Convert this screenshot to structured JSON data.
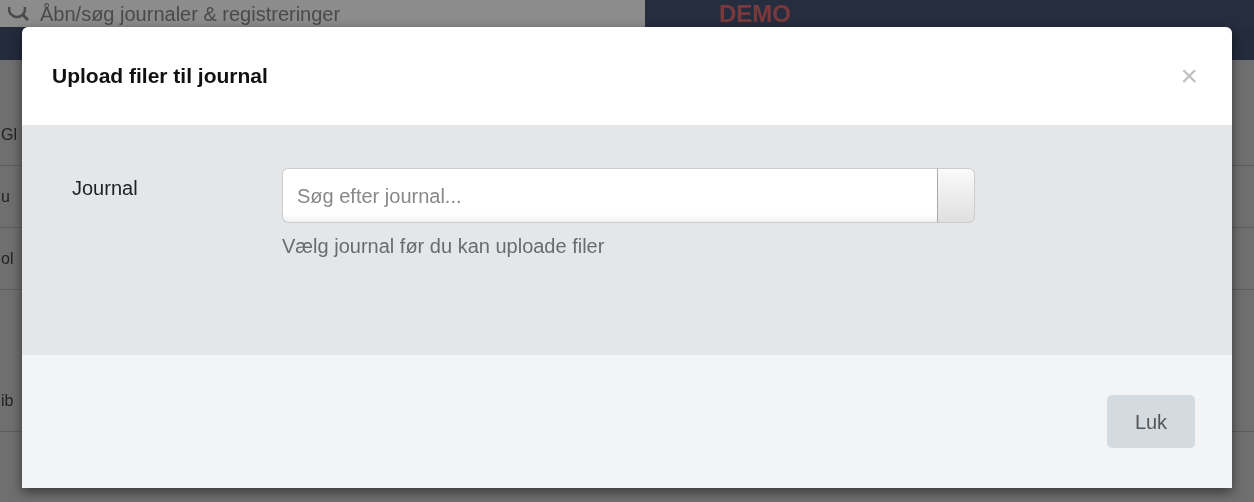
{
  "background": {
    "search_placeholder": "Åbn/søg journaler & registreringer",
    "brand": "DEMO",
    "row_fragments": [
      "Gl",
      "u",
      "ol",
      "ib"
    ]
  },
  "modal": {
    "title": "Upload filer til journal",
    "close": "×",
    "field": {
      "label": "Journal",
      "placeholder": "Søg efter journal...",
      "help": "Vælg journal før du kan uploade filer"
    },
    "buttons": [
      {
        "label": "Luk"
      }
    ]
  }
}
